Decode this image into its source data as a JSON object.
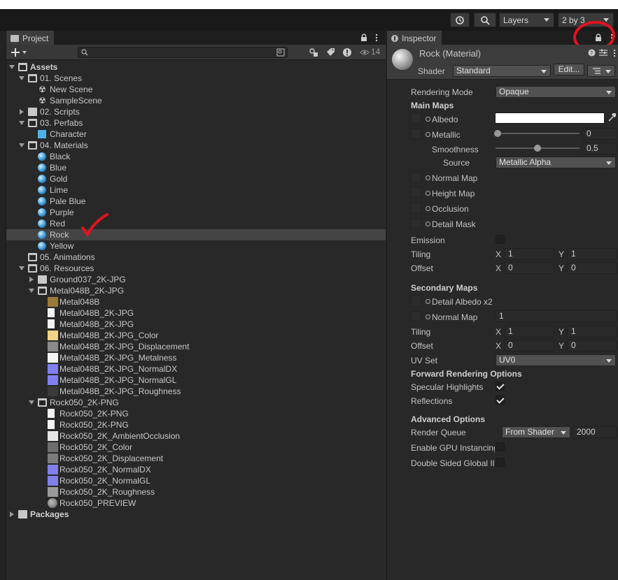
{
  "toolbar": {
    "layers_label": "Layers",
    "layout_label": "2 by 3"
  },
  "project": {
    "tab_label": "Project",
    "hidden_count": "14",
    "tree": [
      {
        "label": "Assets",
        "depth": 0,
        "kind": "folder-open",
        "arrow": "down",
        "bold": true
      },
      {
        "label": "01. Scenes",
        "depth": 1,
        "kind": "folder-open",
        "arrow": "down"
      },
      {
        "label": "New Scene",
        "depth": 2,
        "kind": "scene"
      },
      {
        "label": "SampleScene",
        "depth": 2,
        "kind": "scene"
      },
      {
        "label": "02. Scripts",
        "depth": 1,
        "kind": "folder",
        "arrow": "right"
      },
      {
        "label": "03. Perfabs",
        "depth": 1,
        "kind": "folder-open",
        "arrow": "down"
      },
      {
        "label": "Character",
        "depth": 2,
        "kind": "prefab"
      },
      {
        "label": "04. Materials",
        "depth": 1,
        "kind": "folder-open",
        "arrow": "down"
      },
      {
        "label": "Black",
        "depth": 2,
        "kind": "material"
      },
      {
        "label": "Blue",
        "depth": 2,
        "kind": "material"
      },
      {
        "label": "Gold",
        "depth": 2,
        "kind": "material"
      },
      {
        "label": "Lime",
        "depth": 2,
        "kind": "material"
      },
      {
        "label": "Pale Blue",
        "depth": 2,
        "kind": "material"
      },
      {
        "label": "Purple",
        "depth": 2,
        "kind": "material"
      },
      {
        "label": "Red",
        "depth": 2,
        "kind": "material"
      },
      {
        "label": "Rock",
        "depth": 2,
        "kind": "material",
        "selected": true
      },
      {
        "label": "Yellow",
        "depth": 2,
        "kind": "material"
      },
      {
        "label": "05. Animations",
        "depth": 1,
        "kind": "folder-open"
      },
      {
        "label": "06. Resources",
        "depth": 1,
        "kind": "folder-open",
        "arrow": "down"
      },
      {
        "label": "Ground037_2K-JPG",
        "depth": 2,
        "kind": "folder",
        "arrow": "right"
      },
      {
        "label": "Metal048B_2K-JPG",
        "depth": 2,
        "kind": "folder-open",
        "arrow": "down"
      },
      {
        "label": "Metal048B",
        "depth": 3,
        "kind": "thumb",
        "color": "#9a7a3a"
      },
      {
        "label": "Metal048B_2K-JPG",
        "depth": 3,
        "kind": "doc"
      },
      {
        "label": "Metal048B_2K-JPG",
        "depth": 3,
        "kind": "doc"
      },
      {
        "label": "Metal048B_2K-JPG_Color",
        "depth": 3,
        "kind": "thumb",
        "color": "#f2d489"
      },
      {
        "label": "Metal048B_2K-JPG_Displacement",
        "depth": 3,
        "kind": "thumb",
        "color": "#8a8a8a"
      },
      {
        "label": "Metal048B_2K-JPG_Metalness",
        "depth": 3,
        "kind": "thumb",
        "color": "#f4f4f4"
      },
      {
        "label": "Metal048B_2K-JPG_NormalDX",
        "depth": 3,
        "kind": "thumb",
        "color": "#8080f0"
      },
      {
        "label": "Metal048B_2K-JPG_NormalGL",
        "depth": 3,
        "kind": "thumb",
        "color": "#8080f0"
      },
      {
        "label": "Metal048B_2K-JPG_Roughness",
        "depth": 3,
        "kind": "thumb",
        "color": "#3a3a3a"
      },
      {
        "label": "Rock050_2K-PNG",
        "depth": 2,
        "kind": "folder-open",
        "arrow": "down"
      },
      {
        "label": "Rock050_2K-PNG",
        "depth": 3,
        "kind": "doc"
      },
      {
        "label": "Rock050_2K-PNG",
        "depth": 3,
        "kind": "doc"
      },
      {
        "label": "Rock050_2K_AmbientOcclusion",
        "depth": 3,
        "kind": "thumb",
        "color": "#e6e6e6"
      },
      {
        "label": "Rock050_2K_Color",
        "depth": 3,
        "kind": "thumb",
        "color": "#6e6e6e"
      },
      {
        "label": "Rock050_2K_Displacement",
        "depth": 3,
        "kind": "thumb",
        "color": "#7c7c7c"
      },
      {
        "label": "Rock050_2K_NormalDX",
        "depth": 3,
        "kind": "thumb",
        "color": "#8080e8"
      },
      {
        "label": "Rock050_2K_NormalGL",
        "depth": 3,
        "kind": "thumb",
        "color": "#8080e8"
      },
      {
        "label": "Rock050_2K_Roughness",
        "depth": 3,
        "kind": "thumb",
        "color": "#9a9a9a"
      },
      {
        "label": "Rock050_PREVIEW",
        "depth": 3,
        "kind": "thumb-round",
        "color": "#8c8a86"
      },
      {
        "label": "Packages",
        "depth": 0,
        "kind": "folder",
        "arrow": "right",
        "bold": true
      }
    ]
  },
  "inspector": {
    "tab_label": "Inspector",
    "title": "Rock (Material)",
    "shader_label": "Shader",
    "shader_value": "Standard",
    "edit_label": "Edit...",
    "rendering_mode_label": "Rendering Mode",
    "rendering_mode_value": "Opaque",
    "main_maps_label": "Main Maps",
    "albedo_label": "Albedo",
    "albedo_color": "#ffffff",
    "metallic_label": "Metallic",
    "metallic_value": "0",
    "metallic_fraction": 0,
    "smoothness_label": "Smoothness",
    "smoothness_value": "0.5",
    "smoothness_fraction": 0.5,
    "source_label": "Source",
    "source_value": "Metallic Alpha",
    "normal_map_label": "Normal Map",
    "height_map_label": "Height Map",
    "occlusion_label": "Occlusion",
    "detail_mask_label": "Detail Mask",
    "emission_label": "Emission",
    "tiling_label": "Tiling",
    "offset_label": "Offset",
    "x_label": "X",
    "y_label": "Y",
    "tiling_x": "1",
    "tiling_y": "1",
    "offset_x": "0",
    "offset_y": "0",
    "secondary_maps_label": "Secondary Maps",
    "detail_albedo_label": "Detail Albedo x2",
    "sec_normal_map_label": "Normal Map",
    "sec_normal_value": "1",
    "sec_tiling_x": "1",
    "sec_tiling_y": "1",
    "sec_offset_x": "0",
    "sec_offset_y": "0",
    "uv_set_label": "UV Set",
    "uv_set_value": "UV0",
    "forward_label": "Forward Rendering Options",
    "specular_label": "Specular Highlights",
    "specular_checked": true,
    "reflections_label": "Reflections",
    "reflections_checked": true,
    "advanced_label": "Advanced Options",
    "render_queue_label": "Render Queue",
    "render_queue_mode": "From Shader",
    "render_queue_value": "2000",
    "gpu_instancing_label": "Enable GPU Instancing",
    "double_sided_label": "Double Sided Global Illumination"
  },
  "colors": {
    "annotation_red": "#e0141e",
    "selection": "#444444"
  }
}
